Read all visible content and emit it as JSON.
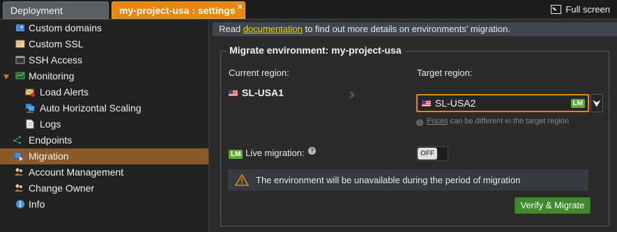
{
  "tabs": {
    "deployment_manager": "Deployment manager",
    "settings": "my-project-usa : settings",
    "close": "×"
  },
  "fullscreen_label": "Full screen",
  "sidebar": {
    "items": [
      {
        "label": "Custom domains",
        "icon": "globe-icon"
      },
      {
        "label": "Custom SSL",
        "icon": "certificate-icon"
      },
      {
        "label": "SSH Access",
        "icon": "terminal-icon"
      },
      {
        "label": "Monitoring",
        "icon": "monitor-icon"
      },
      {
        "label": "Load Alerts",
        "icon": "mail-alert-icon"
      },
      {
        "label": "Auto Horizontal Scaling",
        "icon": "scaling-icon"
      },
      {
        "label": "Logs",
        "icon": "document-icon"
      },
      {
        "label": "Endpoints",
        "icon": "endpoints-icon"
      },
      {
        "label": "Migration",
        "icon": "migration-icon"
      },
      {
        "label": "Account Management",
        "icon": "users-icon"
      },
      {
        "label": "Change Owner",
        "icon": "user-swap-icon"
      },
      {
        "label": "Info",
        "icon": "info-icon"
      }
    ],
    "active": "Migration"
  },
  "info_bar": {
    "prefix": "Read ",
    "link": "documentation",
    "suffix": " to find out more details on environments' migration."
  },
  "migrate": {
    "title": "Migrate environment: my-project-usa",
    "current_region_label": "Current region:",
    "current_region": "SL-USA1",
    "target_region_label": "Target region:",
    "target_region": "SL-USA2",
    "lm_badge": "LM",
    "hint_link": "Prices",
    "hint_text": " can be different in the target region",
    "live_migration_label": "Live migration:",
    "toggle_state": "OFF",
    "warning": "The environment will be unavailable during the period of migration",
    "verify_button": "Verify & Migrate"
  },
  "colors": {
    "accent": "#e8860e",
    "active_item": "#8a5a2a",
    "lm_green": "#5cae2e",
    "button_green": "#3f8a2a",
    "link_yellow": "#e5d700"
  }
}
